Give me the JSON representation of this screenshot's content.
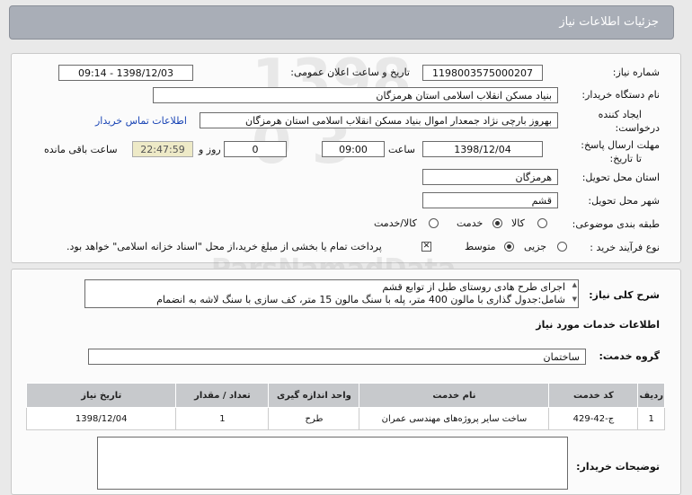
{
  "header": {
    "title": "جزئیات اطلاعات نیاز"
  },
  "form": {
    "need_number_label": "شماره نیاز:",
    "need_number": "1198003575000207",
    "announce_label": "تاریخ و ساعت اعلان عمومی:",
    "announce_value": "1398/12/03 - 09:14",
    "buyer_org_label": "نام دستگاه خریدار:",
    "buyer_org": "بنیاد مسکن انقلاب اسلامی استان هرمزگان",
    "requester_label_1": "ایجاد کننده",
    "requester_label_2": "درخواست:",
    "requester": "بهروز  بارچی نژاد جمعدار اموال بنیاد مسکن انقلاب اسلامی استان هرمزگان",
    "contact_link": "اطلاعات تماس خریدار",
    "deadline_label_1": "مهلت ارسال پاسخ:",
    "deadline_label_2": "تا تاریخ:",
    "deadline_date": "1398/12/04",
    "time_label": "ساعت",
    "deadline_time": "09:00",
    "days_value": "0",
    "days_label": "روز و",
    "remaining_time": "22:47:59",
    "remaining_label": "ساعت باقی مانده",
    "province_label": "استان محل تحویل:",
    "province": "هرمزگان",
    "city_label": "شهر محل تحویل:",
    "city": "قشم",
    "category_label": "طبقه بندی موضوعی:",
    "category_options": [
      "کالا",
      "خدمت",
      "کالا/خدمت"
    ],
    "process_label": "نوع فرآیند خرید :",
    "process_options": [
      "جزیی",
      "متوسط"
    ],
    "payment_note": "پرداخت تمام یا بخشی از مبلغ خرید،از محل \"اسناد خزانه اسلامی\" خواهد بود."
  },
  "details": {
    "description_label": "شرح کلی نیاز:",
    "description_line1": "اجرای  طرح هادی روستای طبل  از توابع قشم",
    "description_line2": "شامل:جدول گذاری با مالون 400 متر، پله با سنگ مالون 15 متر، کف سازی با سنگ لاشه به انضمام",
    "services_heading": "اطلاعات خدمات مورد نیاز",
    "service_group_label": "گروه خدمت:",
    "service_group": "ساختمان",
    "table_headers": [
      "ردیف",
      "کد خدمت",
      "نام خدمت",
      "واحد اندازه گیری",
      "تعداد / مقدار",
      "تاریخ نیاز"
    ],
    "table_rows": [
      {
        "row": "1",
        "code": "ج-42-429",
        "name": "ساخت سایر پروژه‌های مهندسی عمران",
        "unit": "طرح",
        "qty": "1",
        "date": "1398/12/04"
      }
    ],
    "buyer_notes_label": "توضیحات خریدار:",
    "buyer_notes": ""
  }
}
